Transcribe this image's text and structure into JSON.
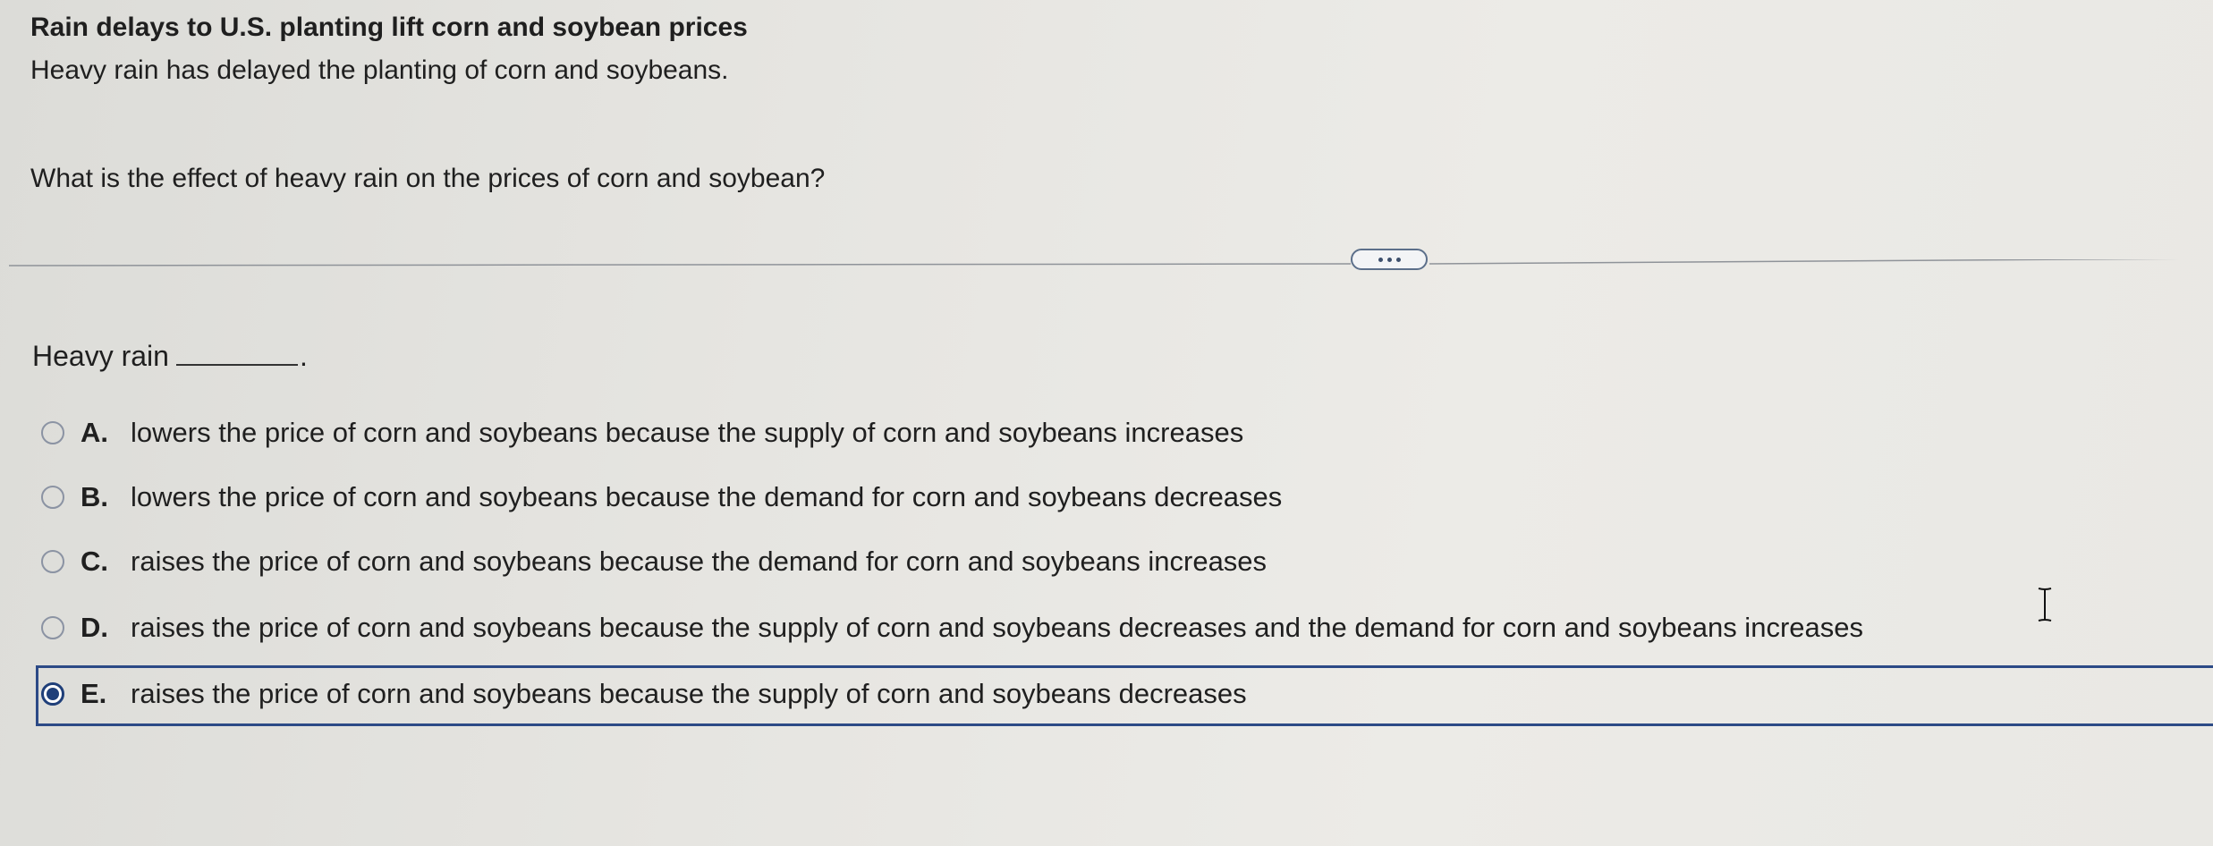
{
  "header": {
    "title": "Rain delays to U.S. planting lift corn and soybean prices",
    "subtitle": "Heavy rain has delayed the planting of corn and soybeans."
  },
  "question": "What is the effect of heavy rain on the prices of corn and soybean?",
  "prompt": {
    "lead": "Heavy rain",
    "end": "."
  },
  "options": [
    {
      "letter": "A.",
      "text": "lowers the price of corn and soybeans because the supply of corn and soybeans increases",
      "selected": false
    },
    {
      "letter": "B.",
      "text": "lowers the price of corn and soybeans because the demand for corn and soybeans decreases",
      "selected": false
    },
    {
      "letter": "C.",
      "text": "raises the price of corn and soybeans because the demand for corn and soybeans increases",
      "selected": false
    },
    {
      "letter": "D.",
      "text": "raises the price of corn and soybeans because the supply of corn and soybeans decreases and the demand for corn and soybeans increases",
      "selected": false
    },
    {
      "letter": "E.",
      "text": "raises the price of corn and soybeans because the supply of corn and soybeans decreases",
      "selected": true
    }
  ],
  "colors": {
    "selection": "#1f3f79",
    "radio_border": "#8b93a3"
  },
  "icons": {
    "more": "ellipsis-icon",
    "cursor": "text-cursor-icon"
  }
}
